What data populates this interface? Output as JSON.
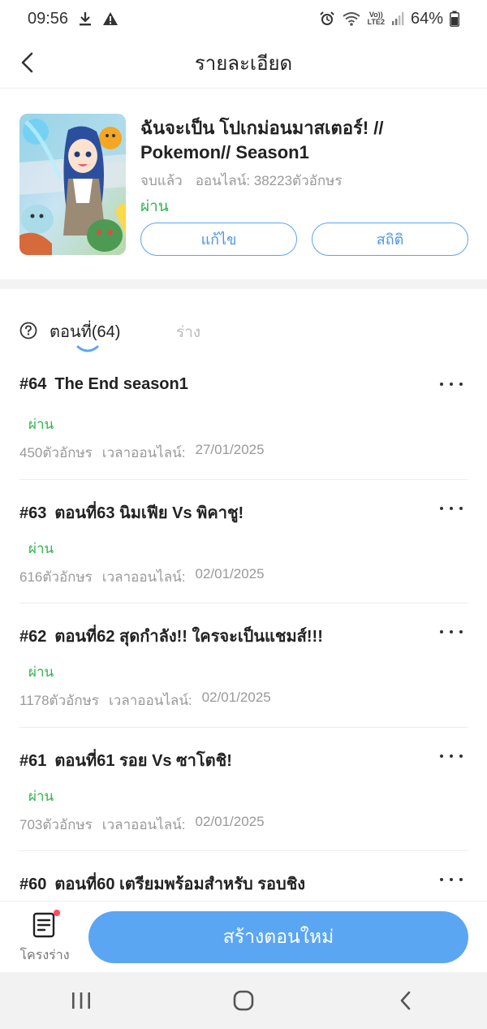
{
  "status_bar": {
    "time": "09:56",
    "battery": "64%",
    "lte": "LTE2",
    "volte": "Vo))",
    "icons": [
      "download-icon",
      "warning-icon",
      "alarm-icon",
      "wifi-icon",
      "signal-icon",
      "battery-icon"
    ]
  },
  "header": {
    "title": "รายละเอียด"
  },
  "book": {
    "title": "ฉันจะเป็น โปเกม่อนมาสเตอร์! // Pokemon// Season1",
    "completion": "จบแล้ว",
    "online": "ออนไลน์: 38223ตัวอักษร",
    "status": "ผ่าน",
    "edit_label": "แก้ไข",
    "stats_label": "สถิติ"
  },
  "tabs": {
    "episodes_label": "ตอนที่(64)",
    "drafts_label": "ร่าง"
  },
  "episodes": [
    {
      "num": "#64",
      "title": "The End season1",
      "status": "ผ่าน",
      "chars": "450ตัวอักษร",
      "online_label": "เวลาออนไลน์:",
      "date": "27/01/2025"
    },
    {
      "num": "#63",
      "title": "ตอนที่63 นิมเฟีย Vs พิคาชู!",
      "status": "ผ่าน",
      "chars": "616ตัวอักษร",
      "online_label": "เวลาออนไลน์:",
      "date": "02/01/2025"
    },
    {
      "num": "#62",
      "title": "ตอนที่62 สุดกำลัง!! ใครจะเป็นแชมส์!!!",
      "status": "ผ่าน",
      "chars": "1178ตัวอักษร",
      "online_label": "เวลาออนไลน์:",
      "date": "02/01/2025"
    },
    {
      "num": "#61",
      "title": "ตอนที่61 รอย Vs ซาโตชิ!",
      "status": "ผ่าน",
      "chars": "703ตัวอักษร",
      "online_label": "เวลาออนไลน์:",
      "date": "02/01/2025"
    },
    {
      "num": "#60",
      "title": "ตอนที่60 เตรียมพร้อมสำหรับ รอบชิง",
      "status": "",
      "chars": "",
      "online_label": "",
      "date": ""
    }
  ],
  "bottom_bar": {
    "draft_label": "โครงร่าง",
    "create_label": "สร้างตอนใหม่"
  },
  "colors": {
    "accent": "#5ba6f2",
    "status_green": "#2fb44a",
    "meta_gray": "#999999"
  }
}
